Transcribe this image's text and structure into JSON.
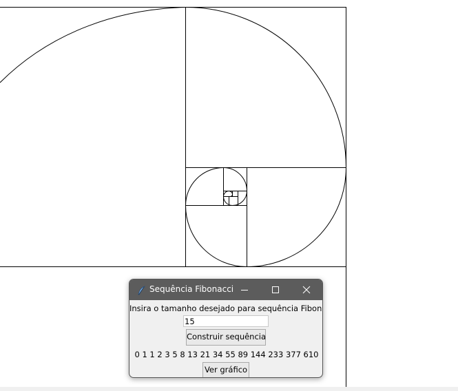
{
  "window": {
    "title": "Sequência Fibonacci",
    "prompt_label": "Insira o tamanho desejado para sequência Fibonacci",
    "size_input_value": "15",
    "build_button_label": "Construir sequência",
    "sequence_text": "0 1 1 2 3 5 8 13 21 34 55 89 144 233 377 610",
    "chart_button_label": "Ver gráfico"
  },
  "icons": {
    "app": "feather-icon",
    "minimize": "minimize-icon",
    "maximize": "maximize-icon",
    "close": "close-icon"
  },
  "drawing": {
    "description_kind": "fibonacci-spiral",
    "line_color": "#000000",
    "background": "#ffffff"
  }
}
